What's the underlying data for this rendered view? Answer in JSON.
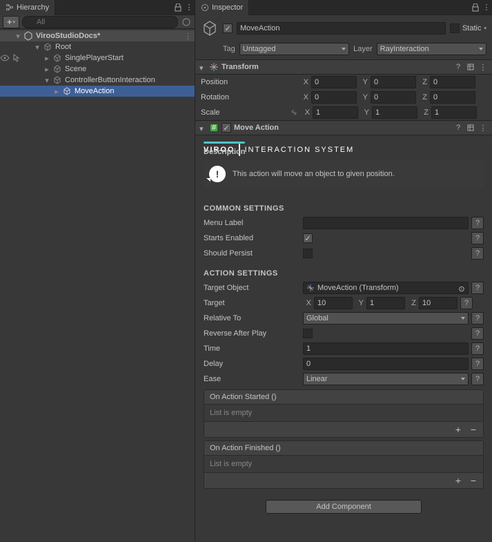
{
  "hierarchy": {
    "title": "Hierarchy",
    "searchPlaceholder": "All",
    "scene": "VirooStudioDocs*",
    "nodes": {
      "root": "Root",
      "sps": "SinglePlayerStart",
      "scene": "Scene",
      "cbi": "ControllerButtonInteraction",
      "ma": "MoveAction"
    }
  },
  "inspector": {
    "title": "Inspector",
    "name": "MoveAction",
    "staticLabel": "Static",
    "tagLabel": "Tag",
    "tagValue": "Untagged",
    "layerLabel": "Layer",
    "layerValue": "RayInteraction"
  },
  "transform": {
    "title": "Transform",
    "position": {
      "label": "Position",
      "x": "0",
      "y": "0",
      "z": "0"
    },
    "rotation": {
      "label": "Rotation",
      "x": "0",
      "y": "0",
      "z": "0"
    },
    "scale": {
      "label": "Scale",
      "x": "1",
      "y": "1",
      "z": "1"
    }
  },
  "moveAction": {
    "title": "Move Action",
    "brand1": "VIROO",
    "brand2": "INTERACTION SYSTEM",
    "descLabel": "Description",
    "descText": "This action will move an object to given position.",
    "commonTitle": "COMMON SETTINGS",
    "menuLabel": "Menu Label",
    "startsEnabled": "Starts Enabled",
    "shouldPersist": "Should Persist",
    "actionTitle": "ACTION SETTINGS",
    "targetObject": "Target Object",
    "targetObjectValue": "MoveAction (Transform)",
    "target": "Target",
    "targetX": "10",
    "targetY": "1",
    "targetZ": "10",
    "relativeTo": "Relative To",
    "relativeToValue": "Global",
    "reverseAfterPlay": "Reverse After Play",
    "time": "Time",
    "timeValue": "1",
    "delay": "Delay",
    "delayValue": "0",
    "ease": "Ease",
    "easeValue": "Linear",
    "onActionStarted": "On Action Started ()",
    "onActionFinished": "On Action Finished ()",
    "listEmpty": "List is empty",
    "addComponent": "Add Component",
    "help": "?",
    "axisX": "X",
    "axisY": "Y",
    "axisZ": "Z"
  }
}
